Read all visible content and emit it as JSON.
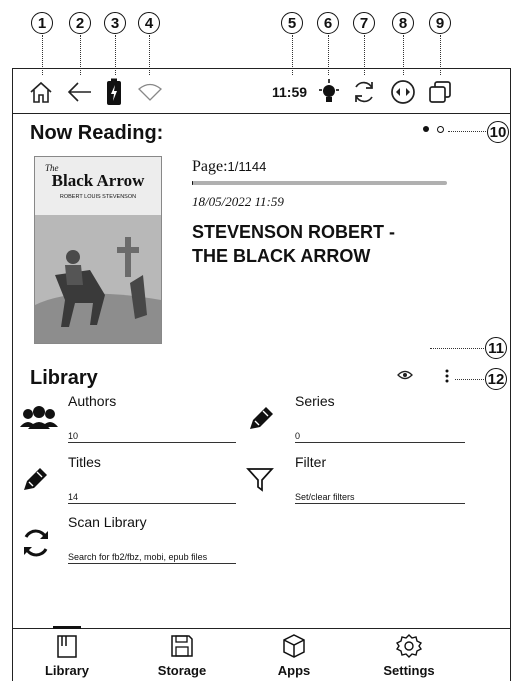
{
  "callouts": [
    "1",
    "2",
    "3",
    "4",
    "5",
    "6",
    "7",
    "8",
    "9",
    "10",
    "11",
    "12"
  ],
  "statusbar": {
    "time": "11:59"
  },
  "now_reading": {
    "title": "Now Reading:",
    "page_label": "Page:",
    "page_value": "1/1144",
    "progress_fraction": 0.0009,
    "timestamp": "18/05/2022 11:59",
    "book_title_line1": "STEVENSON ROBERT -",
    "book_title_line2": "THE BLACK ARROW",
    "cover": {
      "title_small": "The",
      "title_main": "Black Arrow",
      "author": "ROBERT LOUIS STEVENSON"
    }
  },
  "library": {
    "title": "Library",
    "items": [
      {
        "label": "Authors",
        "value": "10",
        "icon": "authors-icon"
      },
      {
        "label": "Series",
        "value": "0",
        "icon": "pencil-icon"
      },
      {
        "label": "Titles",
        "value": "14",
        "icon": "pencil-icon"
      },
      {
        "label": "Filter",
        "value": "Set/clear filters",
        "icon": "filter-icon"
      },
      {
        "label": "Scan Library",
        "value": "Search for fb2/fbz, mobi, epub files",
        "icon": "refresh-icon"
      }
    ]
  },
  "tabs": [
    {
      "label": "Library",
      "icon": "library-icon"
    },
    {
      "label": "Storage",
      "icon": "storage-icon"
    },
    {
      "label": "Apps",
      "icon": "apps-icon"
    },
    {
      "label": "Settings",
      "icon": "settings-icon"
    }
  ],
  "colors": {
    "progress_track": "#b0b0b0",
    "ink": "#111111"
  }
}
